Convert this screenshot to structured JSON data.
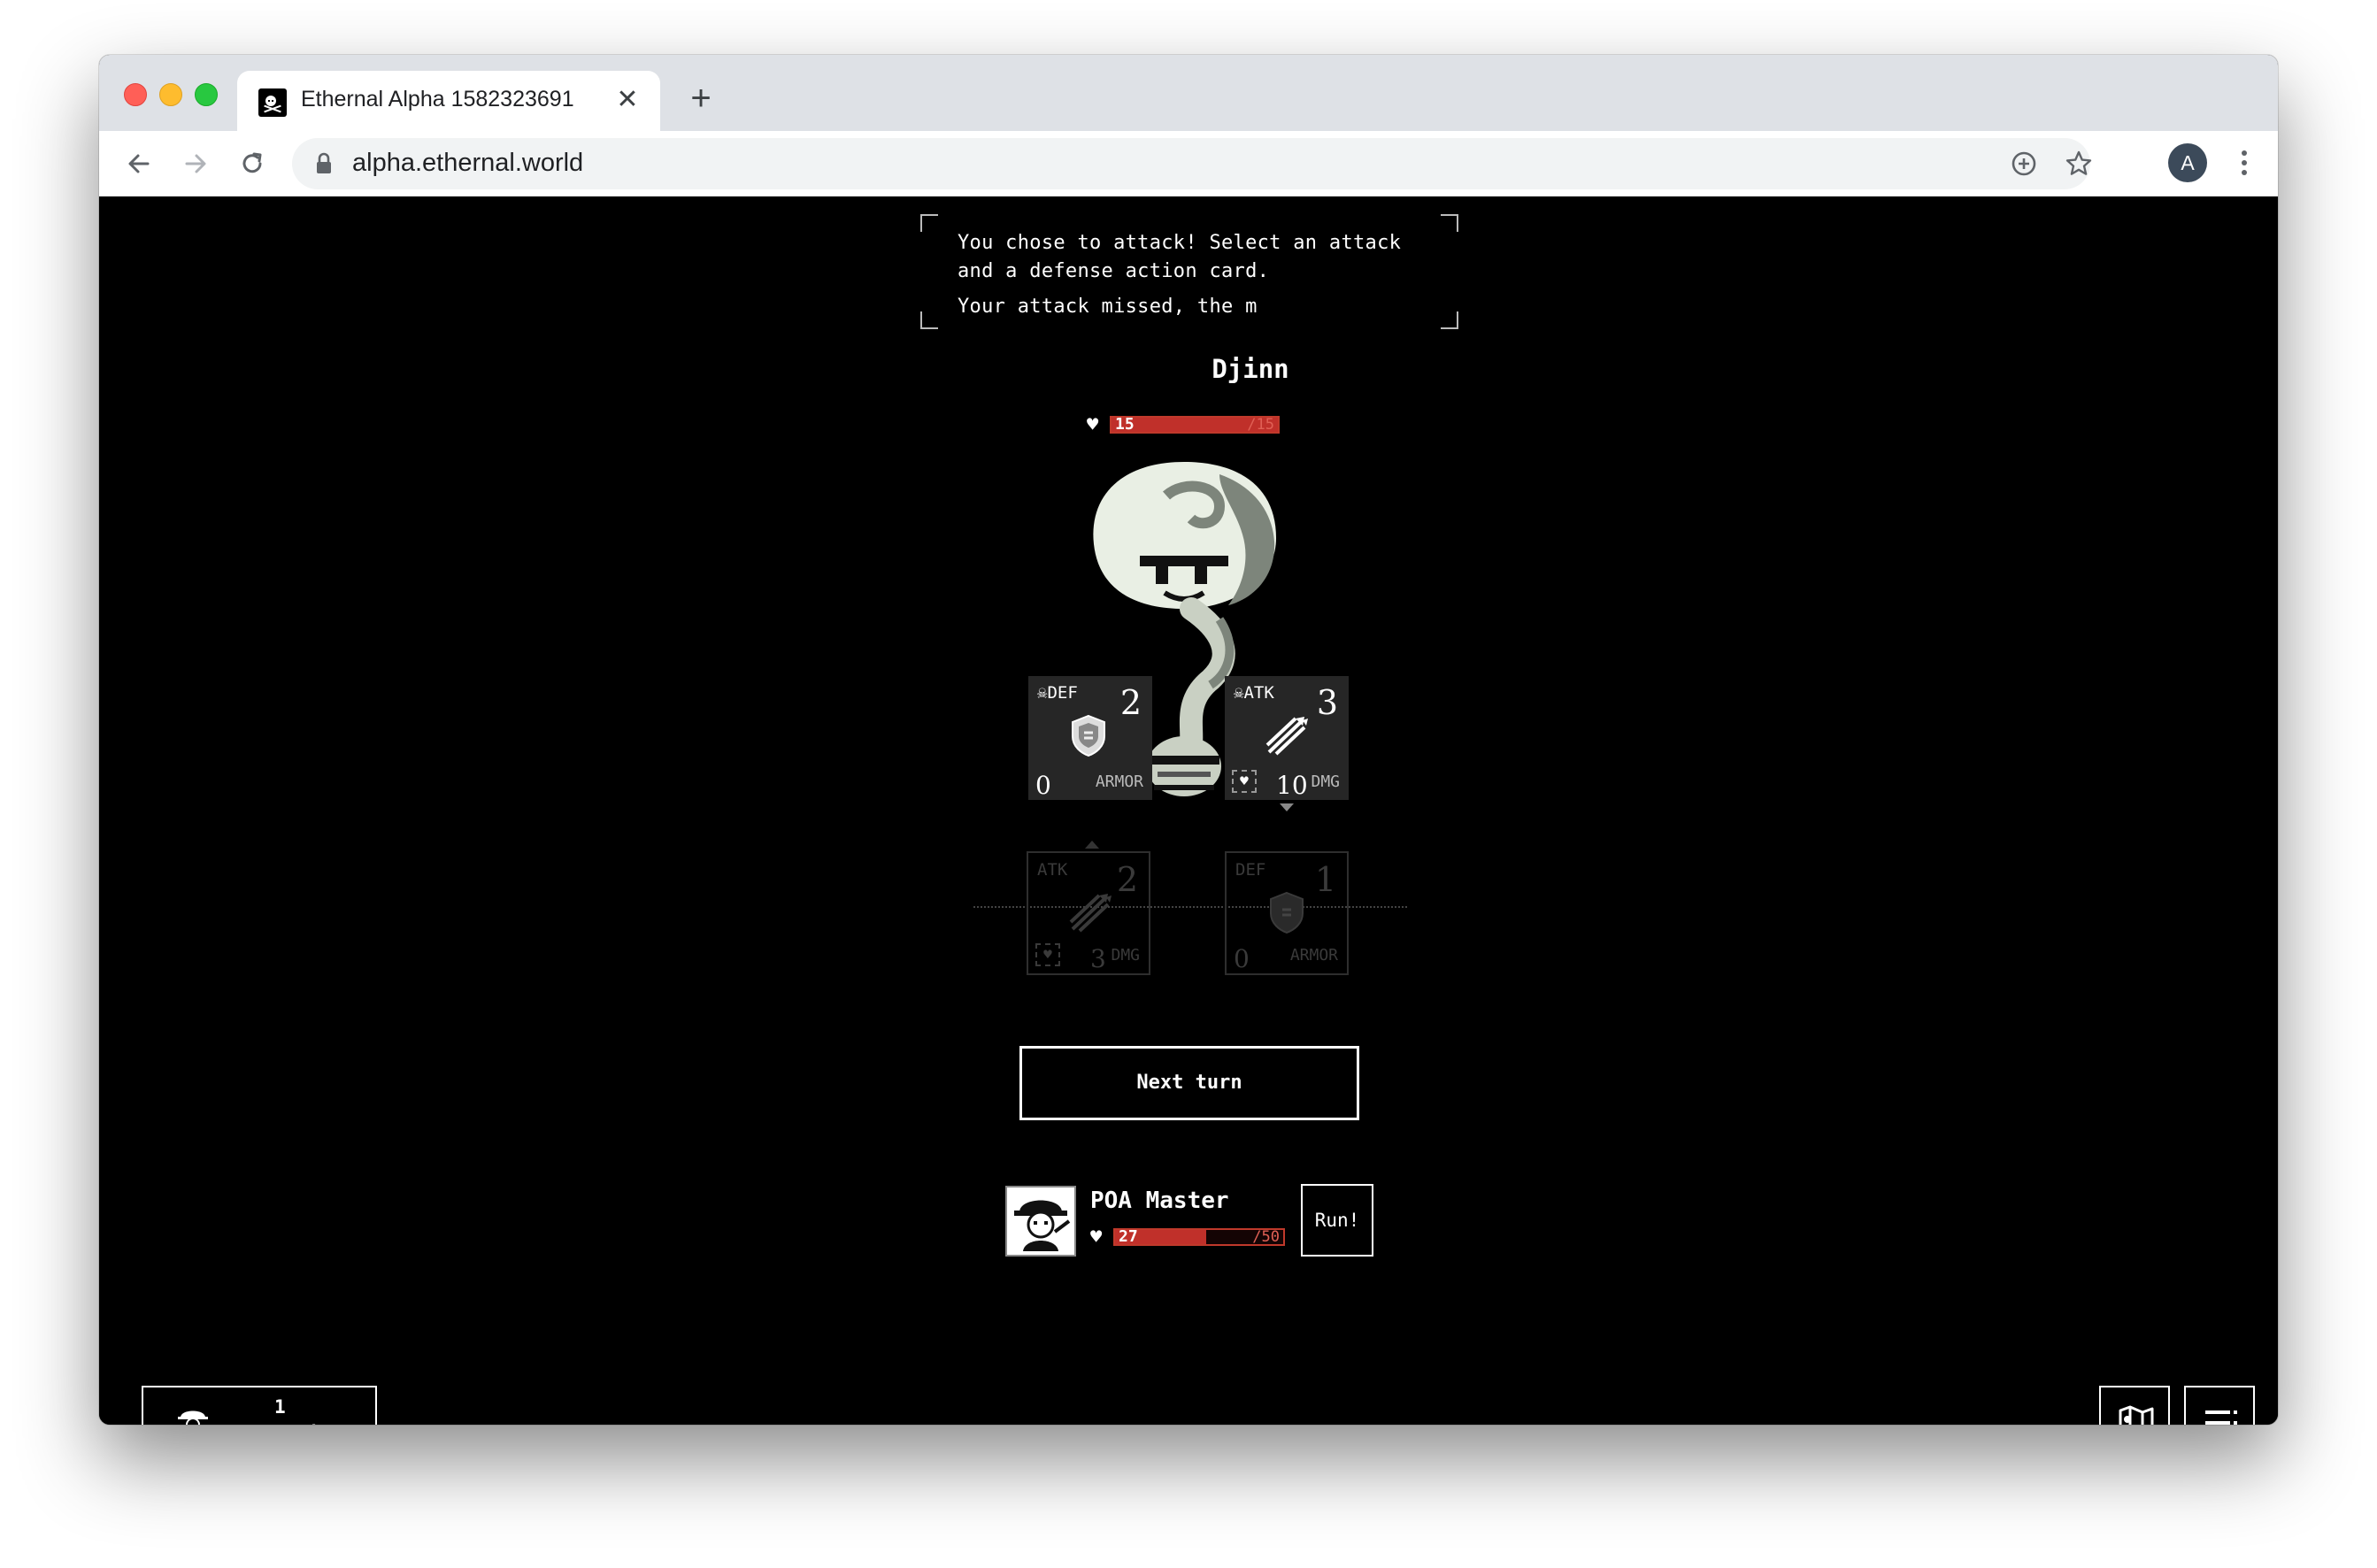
{
  "browser": {
    "tab_title": "Ethernal Alpha 1582323691",
    "tab_close": "✕",
    "new_tab": "+",
    "url": "alpha.ethernal.world",
    "profile_initial": "A"
  },
  "battle": {
    "messages": [
      "You chose to attack! Select an attack",
      "and a defense action card.",
      "Your attack missed, the m"
    ],
    "enemy": {
      "name": "Djinn",
      "hp": "15",
      "hp_max": "/15",
      "hp_fraction": 1.0,
      "cards": [
        {
          "type": "DEF",
          "value": "2",
          "secondary": "0",
          "unit": "ARMOR"
        },
        {
          "type": "ATK",
          "value": "3",
          "secondary": "10",
          "unit": "DMG"
        }
      ]
    },
    "player_cards": [
      {
        "type": "ATK",
        "value": "2",
        "secondary": "3",
        "unit": "DMG"
      },
      {
        "type": "DEF",
        "value": "1",
        "secondary": "0",
        "unit": "ARMOR"
      }
    ],
    "next_turn_label": "Next turn",
    "player": {
      "name": "POA Master",
      "hp": "27",
      "hp_max": "/50",
      "hp_fraction": 0.54
    },
    "run_label": "Run!"
  },
  "footer": {
    "online_count": "1",
    "online_label": "online"
  },
  "colors": {
    "hp_fill": "#c0302a",
    "card_bg": "#262626",
    "background": "#000000"
  },
  "icons": {
    "tab_favicon": "pirate-flag-icon",
    "back": "arrow-left-icon",
    "forward": "arrow-right-icon",
    "reload": "reload-icon",
    "lock": "lock-icon",
    "install": "plus-circle-icon",
    "bookmark": "star-icon",
    "menu": "kebab-menu-icon",
    "map": "map-icon",
    "game_menu": "hamburger-menu-icon"
  }
}
